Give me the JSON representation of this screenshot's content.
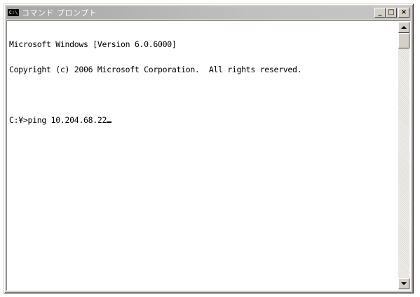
{
  "window": {
    "title": "コマンド プロンプト",
    "icon_label": "C:\\",
    "controls": {
      "minimize": "_",
      "maximize": "□",
      "close": "×"
    }
  },
  "console": {
    "lines": [
      "Microsoft Windows [Version 6.0.6000]",
      "Copyright (c) 2006 Microsoft Corporation.  All rights reserved."
    ],
    "prompt": "C:¥>ping 10.204.68.22"
  },
  "colors": {
    "background": "#ffffff",
    "text": "#000000",
    "frame": "#d4d0c8"
  },
  "icons": {
    "window_icon": "console-icon",
    "scroll_up": "arrow-up-icon",
    "scroll_down": "arrow-down-icon"
  }
}
